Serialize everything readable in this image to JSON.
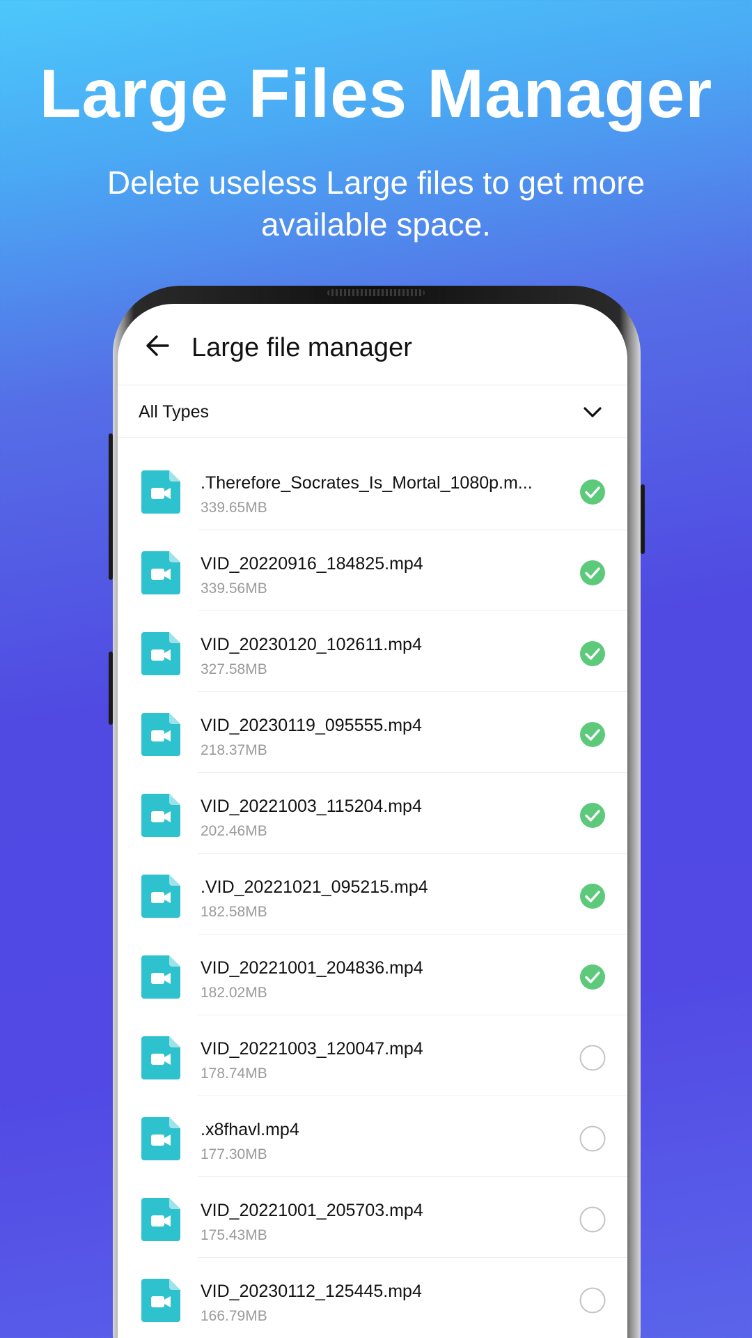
{
  "hero": {
    "title": "Large Files Manager",
    "subtitle": "Delete useless Large files to get more available space."
  },
  "app": {
    "title": "Large file manager",
    "filter": "All Types"
  },
  "colors": {
    "accent": "#2f7cf6",
    "check_green": "#5cc97b",
    "file_icon_teal": "#2ec2cf"
  },
  "files": [
    {
      "name": ".Therefore_Socrates_Is_Mortal_1080p.m...",
      "size": "339.65MB",
      "checked": true
    },
    {
      "name": "VID_20220916_184825.mp4",
      "size": "339.56MB",
      "checked": true
    },
    {
      "name": "VID_20230120_102611.mp4",
      "size": "327.58MB",
      "checked": true
    },
    {
      "name": "VID_20230119_095555.mp4",
      "size": "218.37MB",
      "checked": true
    },
    {
      "name": "VID_20221003_115204.mp4",
      "size": "202.46MB",
      "checked": true
    },
    {
      "name": ".VID_20221021_095215.mp4",
      "size": "182.58MB",
      "checked": true
    },
    {
      "name": "VID_20221001_204836.mp4",
      "size": "182.02MB",
      "checked": true
    },
    {
      "name": "VID_20221003_120047.mp4",
      "size": "178.74MB",
      "checked": false
    },
    {
      "name": ".x8fhavl.mp4",
      "size": "177.30MB",
      "checked": false
    },
    {
      "name": "VID_20221001_205703.mp4",
      "size": "175.43MB",
      "checked": false
    },
    {
      "name": "VID_20230112_125445.mp4",
      "size": "166.79MB",
      "checked": false
    }
  ]
}
